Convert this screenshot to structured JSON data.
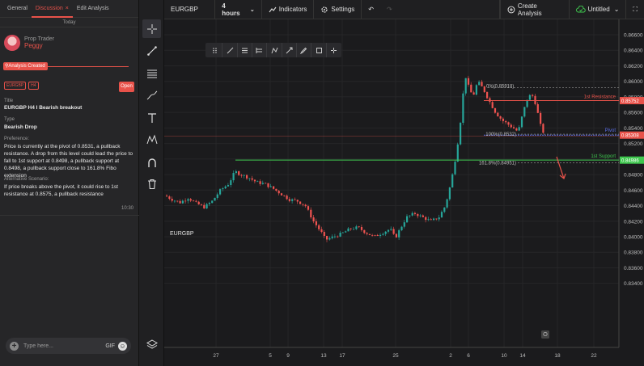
{
  "left_panel": {
    "tabs": [
      {
        "label": "General"
      },
      {
        "label": "Discussion"
      },
      {
        "label": "Edit Analysis"
      }
    ],
    "today_label": "Today",
    "author": {
      "role": "Prop Trader",
      "name": "Peggy"
    },
    "analysis_created_label": "Analysis Created",
    "tags": [
      "EURGBP",
      "H4"
    ],
    "open_label": "Open",
    "title_label": "Title",
    "title_value": "EURGBP H4 I Bearish breakout",
    "type_label": "Type",
    "type_value": "Bearish Drop",
    "preference_label": "Preference:",
    "preference_value": "Price is currently at the pivot of 0.8531, a pullback resistance. A drop from this level could lead the price to fall to 1st support at 0.8498, a pullback support at 0.8498, a pullback support close to 161.8% Fibo extension",
    "alt_label": "Alternative Scenario:",
    "alt_value": "If price breaks above the pivot, it could rise to 1st resistance at 0.8575, a pullback resistance",
    "time": "10:30",
    "composer_placeholder": "Type here...",
    "gif_label": "GIF"
  },
  "header": {
    "symbol": "EURGBP",
    "timeframe": "4 hours",
    "indicators_label": "Indicators",
    "settings_label": "Settings",
    "create_analysis_label": "Create Analysis",
    "untitled_label": "Untitled"
  },
  "chart": {
    "symbol_label": "EURGBP",
    "y_ticks": [
      "0.86600",
      "0.86400",
      "0.86200",
      "0.86000",
      "0.85800",
      "0.85600",
      "0.85400",
      "0.85200",
      "0.85000",
      "0.84800",
      "0.84600",
      "0.84400",
      "0.84200",
      "0.84000",
      "0.83800",
      "0.83600",
      "0.83400"
    ],
    "x_ticks": [
      "27",
      "5",
      "9",
      "13",
      "17",
      "25",
      "2",
      "6",
      "10",
      "14",
      "18",
      "22"
    ],
    "levels": {
      "resistance": {
        "label": "1st Resistance",
        "price": "0.85752",
        "color": "#e8524a"
      },
      "pivot": {
        "label": "Pivot",
        "price": "0.85308",
        "color": "#5a6ee8"
      },
      "support": {
        "label": "1st Support",
        "price": "0.84986",
        "color": "#3fc84f"
      }
    },
    "fibo_labels": [
      "0%(0.85918)",
      "100%(0.8532)",
      "161.8%(0.84951)"
    ]
  },
  "colors": {
    "accent": "#e8524a",
    "bull": "#26a69a",
    "bear": "#ef5350"
  }
}
